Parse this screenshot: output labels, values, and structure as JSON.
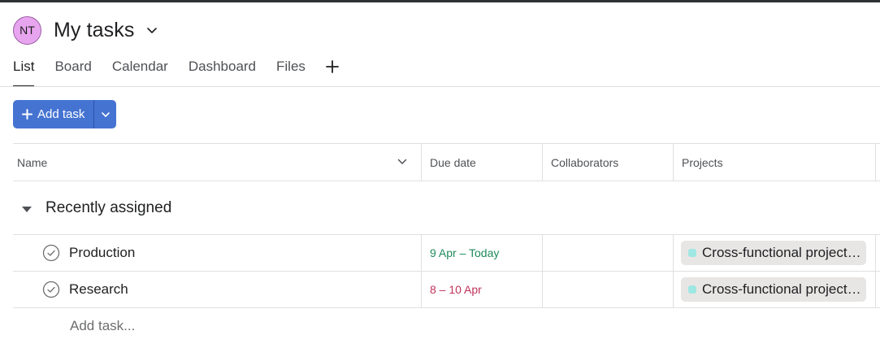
{
  "header": {
    "avatar_initials": "NT",
    "title": "My tasks",
    "avatar_color": "#e8a5ef"
  },
  "tabs": [
    {
      "label": "List",
      "active": true
    },
    {
      "label": "Board",
      "active": false
    },
    {
      "label": "Calendar",
      "active": false
    },
    {
      "label": "Dashboard",
      "active": false
    },
    {
      "label": "Files",
      "active": false
    }
  ],
  "toolbar": {
    "add_task_label": "Add task",
    "accent": "#4573d2"
  },
  "table": {
    "columns": [
      "Name",
      "Due date",
      "Collaborators",
      "Projects"
    ],
    "section_title": "Recently assigned",
    "rows": [
      {
        "name": "Production",
        "due": "9 Apr – Today",
        "due_status": "today",
        "project": "Cross-functional project…"
      },
      {
        "name": "Research",
        "due": "8 – 10 Apr",
        "due_status": "overdue",
        "project": "Cross-functional project…"
      }
    ],
    "add_task_placeholder": "Add task...",
    "due_colors": {
      "today": "#1f8a5b",
      "overdue": "#c0335a"
    },
    "project_color": "#9ee7e3"
  }
}
